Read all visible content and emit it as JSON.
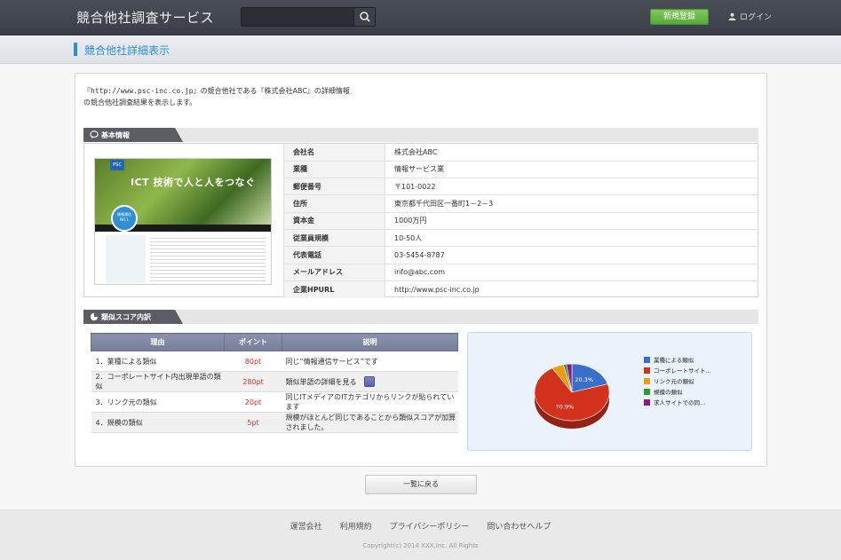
{
  "header": {
    "brand": "競合他社調査サービス",
    "search_placeholder": "",
    "register_label": "新規登録",
    "login_label": "ログイン"
  },
  "page": {
    "title": "競合他社詳細表示"
  },
  "intro": {
    "line1_prefix": "『",
    "url": "http://www.psc-inc.co.jp",
    "line1_suffix": "』の競合他社である『株式会社ABC』の詳細情報",
    "line2": "の競合他社調査結果を表示します。"
  },
  "basic_info": {
    "heading": "基本情報",
    "screenshot": {
      "logo_text": "PSC",
      "hero_text": "ICT 技術で人と人をつなぐ",
      "badge_text": "情報通信 NO.1"
    },
    "rows": [
      {
        "label": "会社名",
        "value": "株式会社ABC"
      },
      {
        "label": "業種",
        "value": "情報サービス業"
      },
      {
        "label": "郵便番号",
        "value": "〒101-0022"
      },
      {
        "label": "住所",
        "value": "東京都千代田区一番町1－2－3"
      },
      {
        "label": "資本金",
        "value": "1000万円"
      },
      {
        "label": "従業員規模",
        "value": "10-50人"
      },
      {
        "label": "代表電話",
        "value": "03-5454-8787"
      },
      {
        "label": "メールアドレス",
        "value": "info@abc.com"
      },
      {
        "label": "企業HPURL",
        "value": "http://www.psc-inc.co.jp"
      }
    ]
  },
  "score": {
    "heading": "類似スコア内訳",
    "columns": [
      "理由",
      "ポイント",
      "説明"
    ],
    "rows": [
      {
        "reason": "1．業種による類似",
        "point": "80pt",
        "desc": "同じ”情報通信サービス”です"
      },
      {
        "reason": "2．コーポレートサイト内出現単語の類似",
        "point": "280pt",
        "desc": "類似単語の詳細を見る"
      },
      {
        "reason": "3．リンク元の類似",
        "point": "20pt",
        "desc": "同じITメディアのITカテゴリからリンクが貼られています"
      },
      {
        "reason": "4．規模の類似",
        "point": "5pt",
        "desc": "規模がほとんど同じであることから類似スコアが加算されました。"
      }
    ]
  },
  "chart_data": {
    "type": "pie",
    "series": [
      {
        "name": "業種による類似",
        "value": 20.3,
        "color": "#3a6fc9"
      },
      {
        "name": "コーポレートサイト...",
        "value": 70.9,
        "color": "#d2311c"
      },
      {
        "name": "リンク元の類似",
        "value": 5.1,
        "color": "#f09a12"
      },
      {
        "name": "規模の類似",
        "value": 1.3,
        "color": "#2c9a2c"
      },
      {
        "name": "求人サイトでの同...",
        "value": 2.4,
        "color": "#8a1a8a"
      }
    ],
    "data_labels": [
      "20.3%",
      "70.9%"
    ],
    "legend_position": "right"
  },
  "actions": {
    "back_label": "一覧に戻る"
  },
  "footer": {
    "links": [
      "運営会社",
      "利用規約",
      "プライバシーポリシー",
      "問い合わせヘルプ"
    ],
    "copyright": "Copyright(c) 2014 XXX,Inc. All Rights"
  }
}
